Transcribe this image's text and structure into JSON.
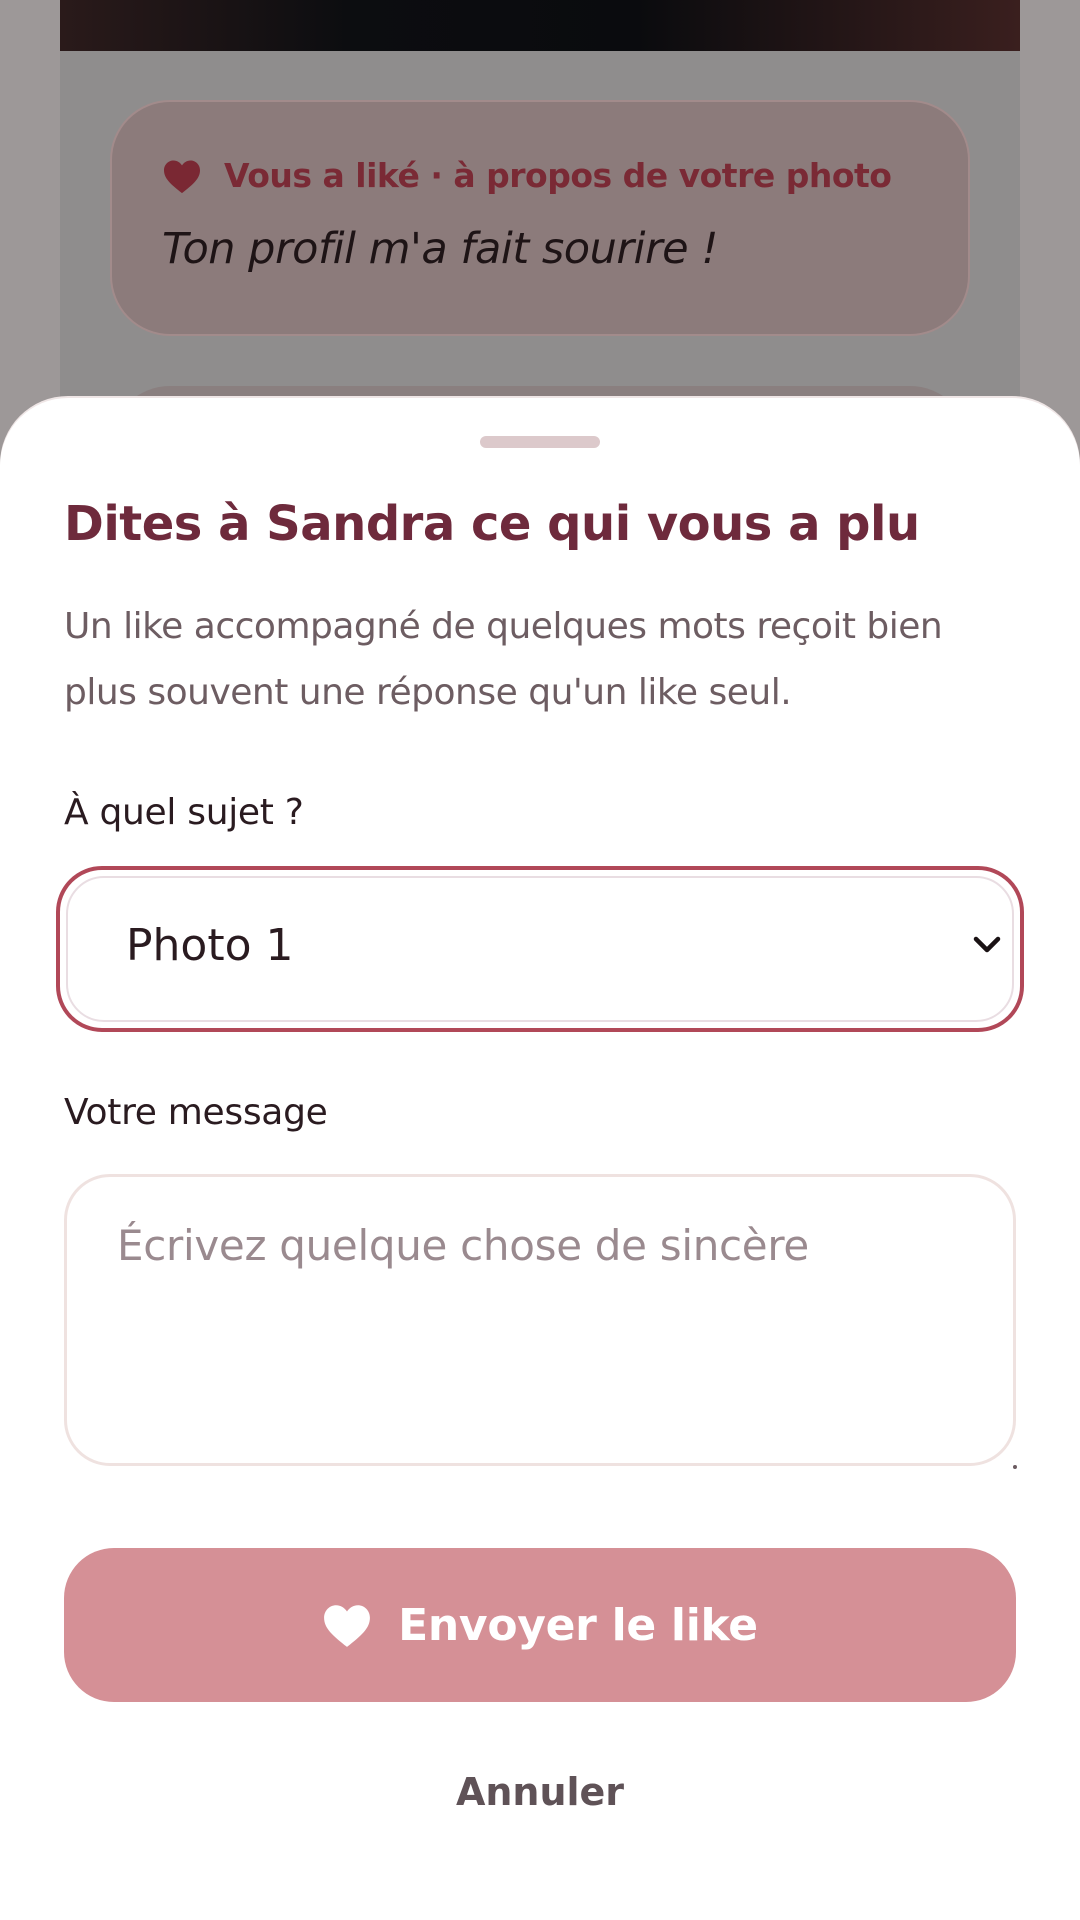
{
  "background": {
    "like_card": {
      "title": "Vous a liké · à propos de votre photo",
      "message": "Ton profil m'a fait sourire !",
      "icon": "heart-icon"
    }
  },
  "sheet": {
    "title": "Dites à Sandra ce qui vous a plu",
    "subtitle": "Un like accompagné de quelques mots reçoit bien plus souvent une réponse qu'un like seul.",
    "subject_label": "À quel sujet ?",
    "subject_selected": "Photo 1",
    "message_label": "Votre message",
    "message_placeholder": "Écrivez quelque chose de sincère",
    "message_value": "",
    "send_label": "Envoyer le like",
    "cancel_label": "Annuler"
  },
  "colors": {
    "accent": "#b14858",
    "title": "#6e2a3c",
    "send_button": "#d59096",
    "heart": "#8e2b3a"
  }
}
